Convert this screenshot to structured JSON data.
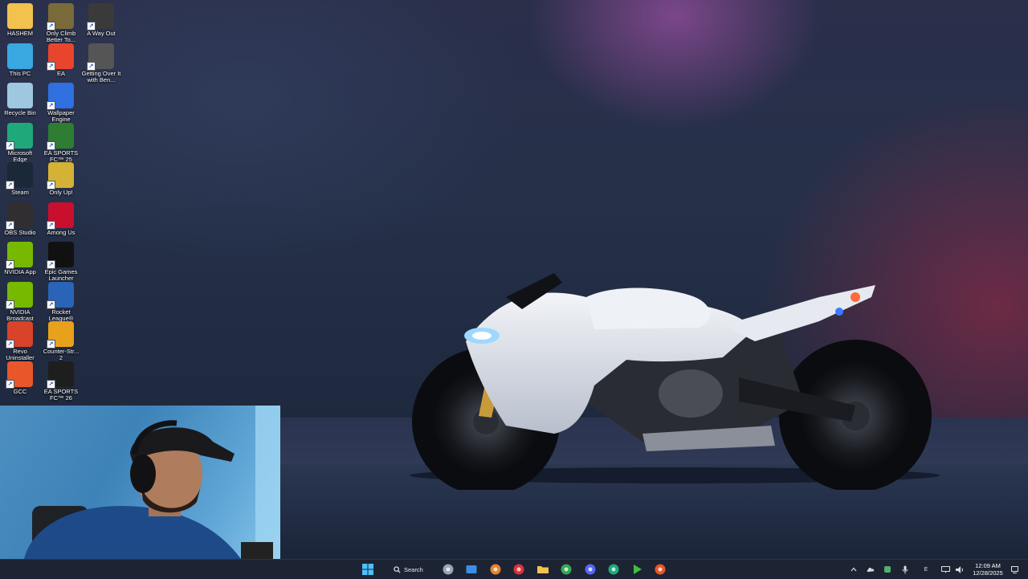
{
  "desktop_icons": [
    {
      "label": "HASHEM",
      "icon": "folder-icon",
      "color": "#f2c14e"
    },
    {
      "label": "Only Climb Better To...",
      "icon": "game-cover-icon",
      "color": "#7a6a3a"
    },
    {
      "label": "A Way Out",
      "icon": "game-cover-icon",
      "color": "#3a3a3a"
    },
    {
      "label": "This PC",
      "icon": "monitor-icon",
      "color": "#39a7e0"
    },
    {
      "label": "EA",
      "icon": "ea-logo-icon",
      "color": "#e8452c"
    },
    {
      "label": "Getting Over It with Ben...",
      "icon": "hammer-icon",
      "color": "#555555"
    },
    {
      "label": "Recycle Bin",
      "icon": "recycle-bin-icon",
      "color": "#9fc7e0"
    },
    {
      "label": "Wallpaper Engine",
      "icon": "wallpaper-engine-icon",
      "color": "#2f6fe0"
    },
    {
      "label": "Microsoft Edge",
      "icon": "edge-icon",
      "color": "#1fa87a"
    },
    {
      "label": "EA SPORTS FC™ 25",
      "icon": "fc25-icon",
      "color": "#2e7d32"
    },
    {
      "label": "Steam",
      "icon": "steam-icon",
      "color": "#1b2838"
    },
    {
      "label": "Only Up!",
      "icon": "only-up-icon",
      "color": "#d4b236"
    },
    {
      "label": "OBS Studio",
      "icon": "obs-icon",
      "color": "#302e31"
    },
    {
      "label": "Among Us",
      "icon": "among-us-icon",
      "color": "#c8102e"
    },
    {
      "label": "NVIDIA App",
      "icon": "nvidia-icon",
      "color": "#76b900"
    },
    {
      "label": "Epic Games Launcher",
      "icon": "epic-games-icon",
      "color": "#111111"
    },
    {
      "label": "NVIDIA Broadcast",
      "icon": "nvidia-broadcast-icon",
      "color": "#76b900"
    },
    {
      "label": "Rocket League®",
      "icon": "rocket-league-icon",
      "color": "#2a64b8"
    },
    {
      "label": "Revo Uninstaller",
      "icon": "revo-uninstaller-icon",
      "color": "#d8432a"
    },
    {
      "label": "Counter-Str... 2",
      "icon": "cs2-icon",
      "color": "#e7a11a"
    },
    {
      "label": "GCC",
      "icon": "gcc-icon",
      "color": "#e8562a"
    },
    {
      "label": "EA SPORTS FC™ 26",
      "icon": "fc26-icon",
      "color": "#1e1e1e"
    }
  ],
  "taskbar": {
    "search_label": "Search",
    "apps": [
      {
        "name": "start-button",
        "icon": "windows-logo-icon",
        "color": "#4cc2ff"
      },
      {
        "name": "settings-app",
        "icon": "gear-icon",
        "color": "#9aa4b2"
      },
      {
        "name": "photos-app",
        "icon": "photos-icon",
        "color": "#3a8ee6"
      },
      {
        "name": "cloud-app",
        "icon": "cloud-icon",
        "color": "#e8822a"
      },
      {
        "name": "red-app",
        "icon": "circle-red-icon",
        "color": "#e0303a"
      },
      {
        "name": "file-explorer",
        "icon": "folder-icon",
        "color": "#f2c14e"
      },
      {
        "name": "chrome",
        "icon": "chrome-icon",
        "color": "#34a853"
      },
      {
        "name": "discord",
        "icon": "discord-icon",
        "color": "#5865f2"
      },
      {
        "name": "edge",
        "icon": "edge-icon",
        "color": "#1fa87a"
      },
      {
        "name": "green-play-app",
        "icon": "play-icon",
        "color": "#3fbf3f"
      },
      {
        "name": "gcc-app",
        "icon": "gcc-icon",
        "color": "#e8562a"
      }
    ],
    "tray": {
      "chevron": "chevron-up-icon",
      "language": "E",
      "time": "12:09 AM",
      "date": "12/28/2025"
    }
  }
}
